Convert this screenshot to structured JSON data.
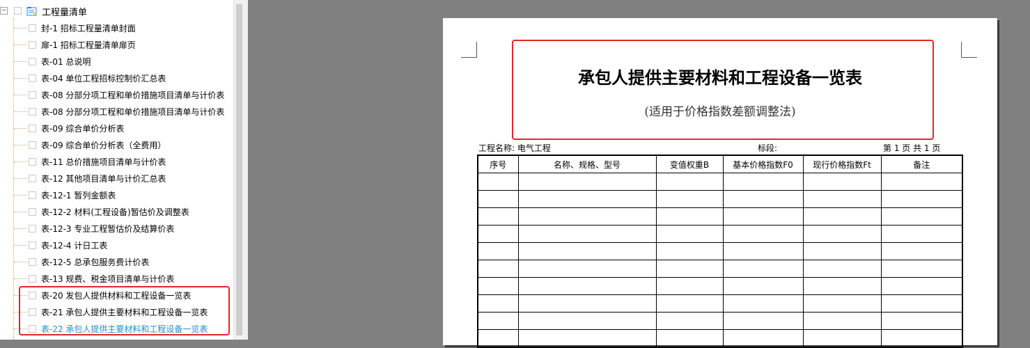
{
  "tree": {
    "root_label": "工程量清单",
    "items": [
      {
        "label": "封-1 招标工程量清单封面"
      },
      {
        "label": "扉-1 招标工程量清单扉页"
      },
      {
        "label": "表-01 总说明"
      },
      {
        "label": "表-04 单位工程招标控制价汇总表"
      },
      {
        "label": "表-08 分部分项工程和单价措施项目清单与计价表"
      },
      {
        "label": "表-08 分部分项工程和单价措施项目清单与计价表"
      },
      {
        "label": "表-09 综合单价分析表"
      },
      {
        "label": "表-09 综合单价分析表（全费用）"
      },
      {
        "label": "表-11 总价措施项目清单与计价表"
      },
      {
        "label": "表-12 其他项目清单与计价汇总表"
      },
      {
        "label": "表-12-1 暂列金额表"
      },
      {
        "label": "表-12-2 材料(工程设备)暂估价及调整表"
      },
      {
        "label": "表-12-3 专业工程暂估价及结算价表"
      },
      {
        "label": "表-12-4 计日工表"
      },
      {
        "label": "表-12-5 总承包服务费计价表"
      },
      {
        "label": "表-13 规费、税金项目清单与计价表"
      },
      {
        "label": "表-20 发包人提供材料和工程设备一览表"
      },
      {
        "label": "表-21 承包人提供主要材料和工程设备一览表"
      },
      {
        "label": "表-22 承包人提供主要材料和工程设备一览表"
      }
    ]
  },
  "document": {
    "title": "承包人提供主要材料和工程设备一览表",
    "subtitle": "(适用于价格指数差额调整法)",
    "project_name": "工程名称: 电气工程",
    "bid_section": "标段:",
    "pages": "第 1 页   共 1 页",
    "columns": [
      "序号",
      "名称、规格、型号",
      "变值权重B",
      "基本价格指数F0",
      "现行价格指数Ft",
      "备注"
    ]
  },
  "colors": {
    "selected_item": "#1e90c8",
    "highlight_border": "#e0262b",
    "background": "#808080"
  }
}
